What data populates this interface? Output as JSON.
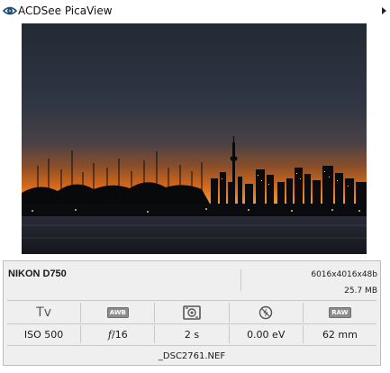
{
  "app": {
    "title": "ACDSee PicaView"
  },
  "photo": {
    "alt": ""
  },
  "info": {
    "camera_model": "NIKON D750",
    "dimensions": "6016x4016x48b",
    "file_size": "25.7 MB",
    "icons": [
      {
        "name": "shooting-mode-icon",
        "label": "Tv"
      },
      {
        "name": "white-balance-icon",
        "label": "AWB"
      },
      {
        "name": "metering-icon",
        "label": ""
      },
      {
        "name": "flash-off-icon",
        "label": ""
      },
      {
        "name": "raw-format-icon",
        "label": "RAW"
      }
    ],
    "values": {
      "iso": "ISO 500",
      "aperture_prefix": "f",
      "aperture_value": "/16",
      "shutter": "2 s",
      "exposure_comp": "0.00 eV",
      "focal_length": "62 mm"
    },
    "filename": "_DSC2761.NEF"
  }
}
